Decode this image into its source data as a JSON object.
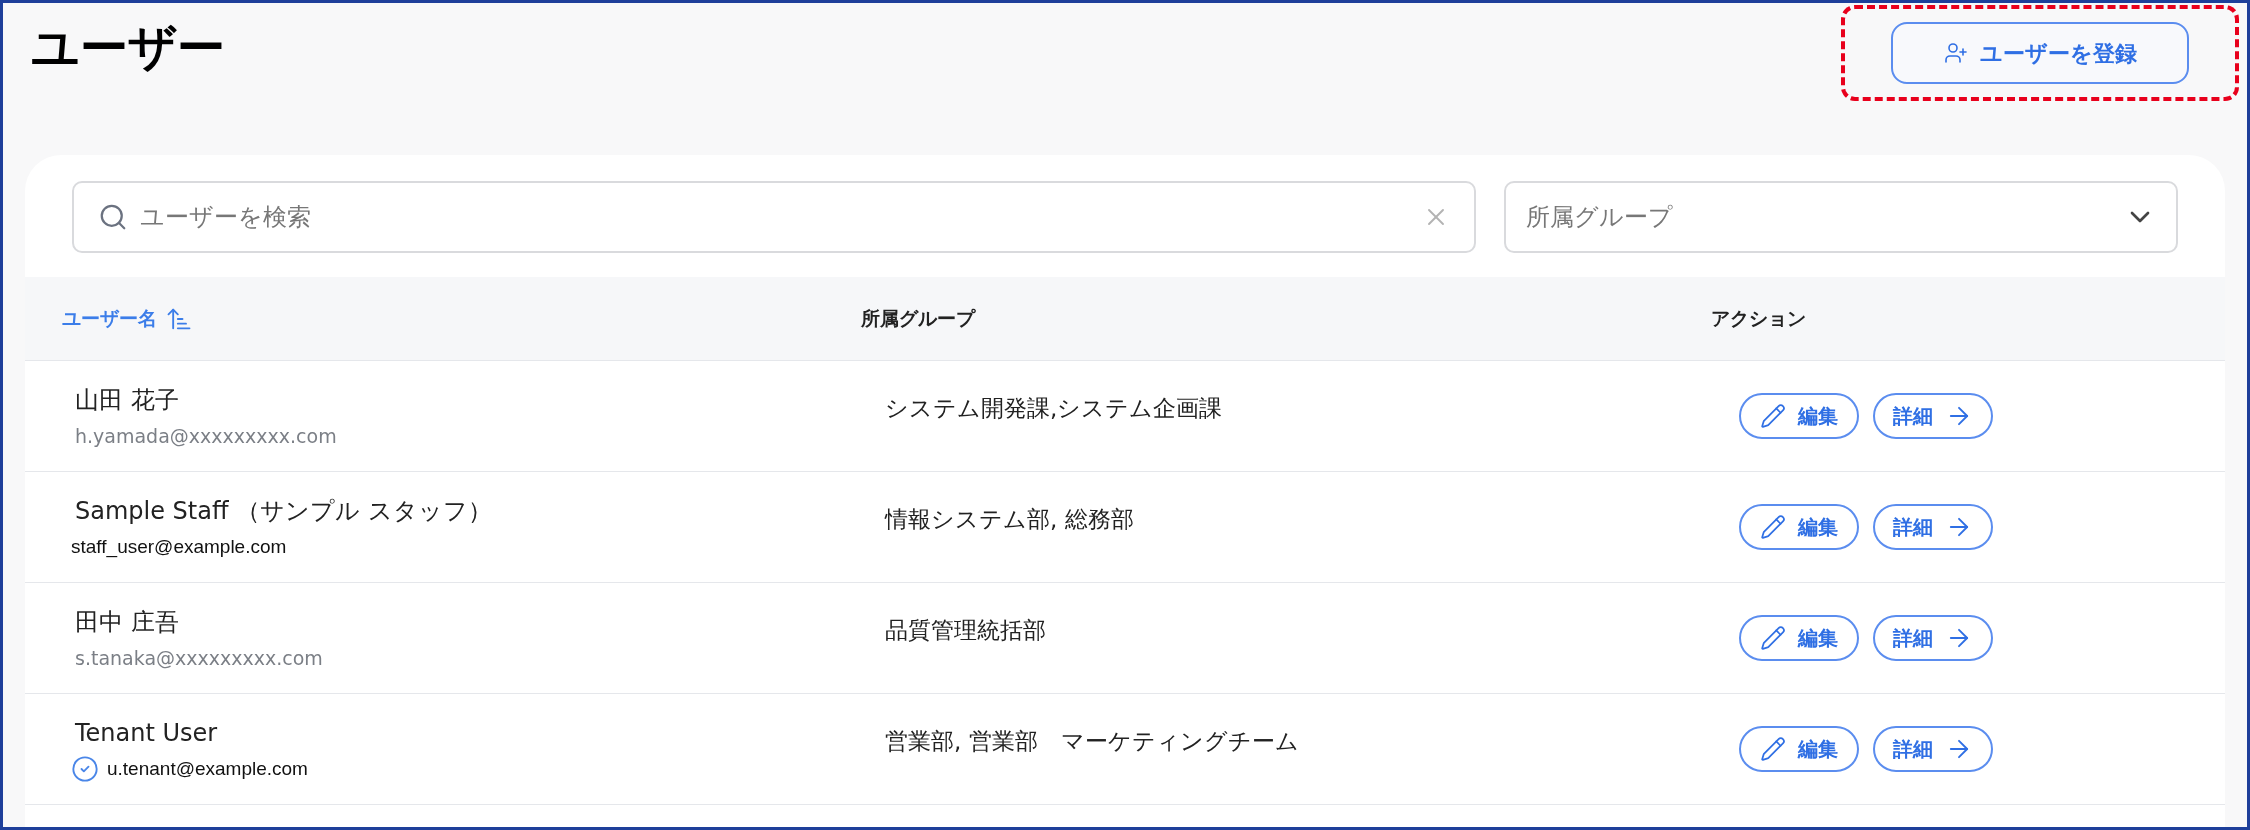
{
  "page": {
    "title": "ユーザー",
    "register_button": "ユーザーを登録",
    "register_highlighted": true
  },
  "search": {
    "placeholder": "ユーザーを検索"
  },
  "group_filter": {
    "placeholder": "所属グループ"
  },
  "table": {
    "columns": [
      {
        "label": "ユーザー名",
        "sorted": true
      },
      {
        "label": "所属グループ"
      },
      {
        "label": "アクション"
      }
    ],
    "rows": [
      {
        "name": "山田 花子",
        "email": "h.yamada@xxxxxxxxx.com",
        "email_muted": true,
        "verified": false,
        "groups": "システム開発課,システム企画課",
        "edit": "編集",
        "details": "詳細"
      },
      {
        "name": "Sample Staff （サンプル スタッフ）",
        "email": "staff_user@example.com",
        "email_muted": false,
        "verified": false,
        "groups": "情報システム部, 総務部",
        "edit": "編集",
        "details": "詳細"
      },
      {
        "name": "田中 庄吾",
        "email": "s.tanaka@xxxxxxxxx.com",
        "email_muted": true,
        "verified": false,
        "groups": "品質管理統括部",
        "edit": "編集",
        "details": "詳細"
      },
      {
        "name": "Tenant User",
        "email": "u.tenant@example.com",
        "email_muted": false,
        "verified": true,
        "groups": "営業部, 営業部　マーケティングチーム",
        "edit": "編集",
        "details": "詳細"
      }
    ]
  }
}
